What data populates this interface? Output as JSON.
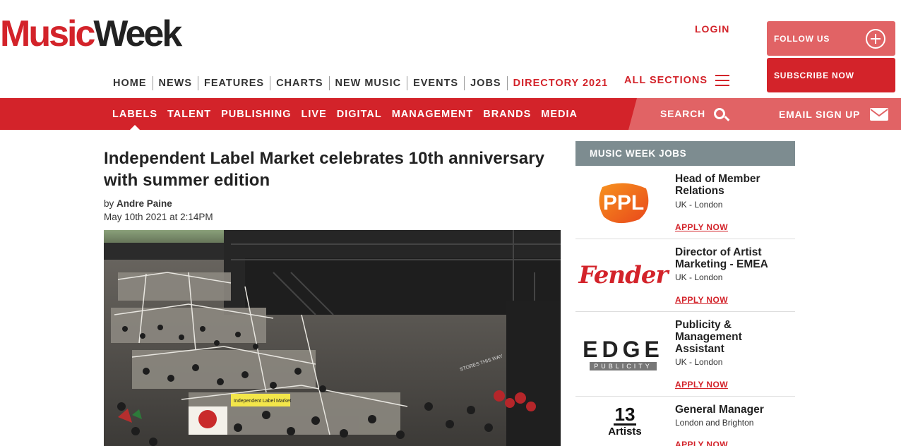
{
  "brand": {
    "logo_part1": "Music",
    "logo_part2": "Week"
  },
  "header": {
    "login": "LOGIN",
    "follow_us": "FOLLOW US",
    "subscribe": "SUBSCRIBE NOW",
    "all_sections": "ALL SECTIONS"
  },
  "mainnav": [
    "HOME",
    "NEWS",
    "FEATURES",
    "CHARTS",
    "NEW MUSIC",
    "EVENTS",
    "JOBS",
    "DIRECTORY 2021"
  ],
  "subnav": [
    "LABELS",
    "TALENT",
    "PUBLISHING",
    "LIVE",
    "DIGITAL",
    "MANAGEMENT",
    "BRANDS",
    "MEDIA"
  ],
  "subnav_active": "LABELS",
  "search_label": "SEARCH",
  "email_label": "EMAIL SIGN UP",
  "article": {
    "headline": "Independent Label Market celebrates 10th anniversary with summer edition",
    "by": "by",
    "author": "Andre Paine",
    "date": "May 10th 2021 at 2:14PM",
    "photo_signs": {
      "stall_sign": "Independent Label Market",
      "stores": "STORES THIS WAY"
    }
  },
  "jobs": {
    "header": "MUSIC WEEK JOBS",
    "apply_label": "APPLY NOW",
    "items": [
      {
        "logo": "PPL",
        "title": "Head of Member Relations",
        "location": "UK - London"
      },
      {
        "logo": "Fender",
        "title": "Director of Artist Marketing - EMEA",
        "location": "UK - London"
      },
      {
        "logo": "EDGE",
        "logo_sub": "PUBLICITY",
        "title": "Publicity & Management Assistant",
        "location": "UK - London"
      },
      {
        "logo": "13",
        "logo_sub": "Artists",
        "title": "General Manager",
        "location": "London and Brighton"
      }
    ]
  },
  "colors": {
    "brand_red": "#d3232a",
    "light_red": "#e16365",
    "jobs_header": "#7d8c90"
  }
}
